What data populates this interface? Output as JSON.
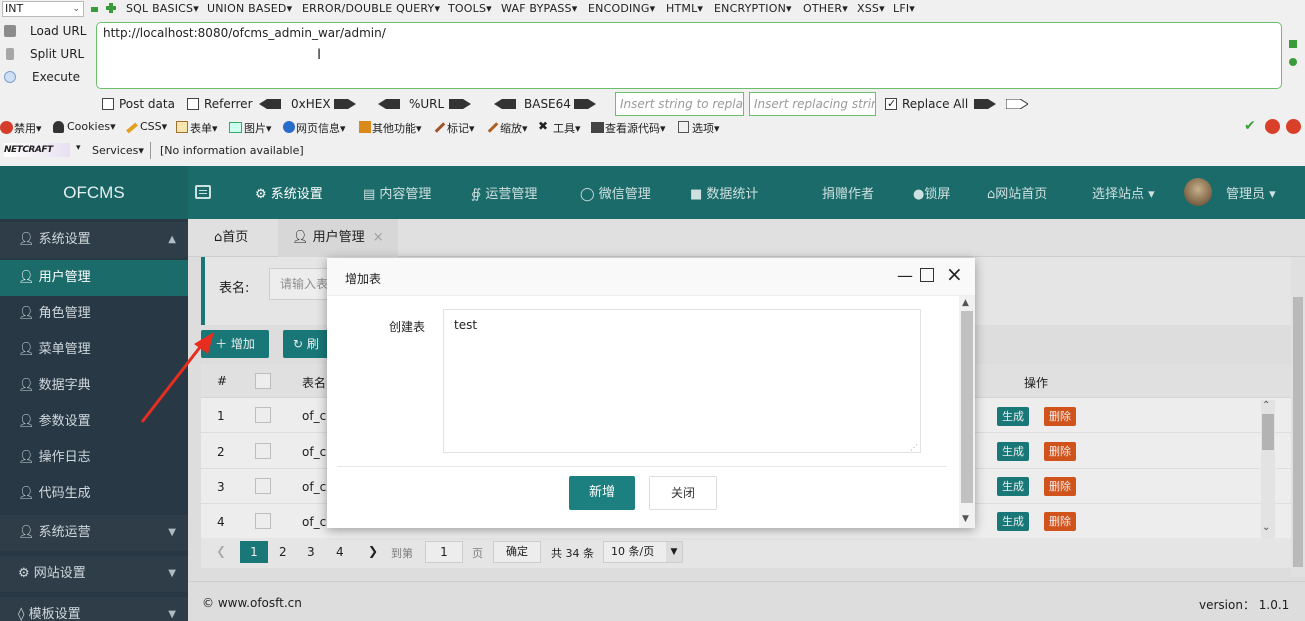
{
  "hackbar": {
    "type_select": "INT",
    "menus": [
      "SQL BASICS▾",
      "UNION BASED▾",
      "ERROR/DOUBLE QUERY▾",
      "TOOLS▾",
      "WAF BYPASS▾",
      "ENCODING▾",
      "HTML▾",
      "ENCRYPTION▾",
      "OTHER▾",
      "XSS▾",
      "LFI▾"
    ],
    "load_url": "Load URL",
    "split_url": "Split URL",
    "execute": "Execute",
    "url_value": "http://localhost:8080/ofcms_admin_war/admin/",
    "post_data": "Post data",
    "referrer": "Referrer",
    "hex": "0xHEX",
    "url_enc": "%URL",
    "base64": "BASE64",
    "insert_placeholder": "Insert string to replace",
    "replacing_placeholder": "Insert replacing string",
    "replace_all": "Replace All"
  },
  "webdev": {
    "items": [
      "禁用▾",
      "Cookies▾",
      "CSS▾",
      "表单▾",
      "图片▾",
      "网页信息▾",
      "其他功能▾",
      "标记▾",
      "缩放▾",
      "工具▾",
      "查看源代码▾",
      "选项▾"
    ]
  },
  "netcraft": {
    "logo": "NETCRAFT",
    "services": "Services▾",
    "info": "[No information available]"
  },
  "app": {
    "logo": "OFCMS",
    "nav": [
      "系统设置",
      "内容管理",
      "运营管理",
      "微信管理",
      "数据统计",
      "捐赠作者",
      "锁屏",
      "网站首页",
      "选择站点"
    ],
    "admin": "管理员"
  },
  "sidebar": {
    "items": [
      "系统设置",
      "用户管理",
      "角色管理",
      "菜单管理",
      "数据字典",
      "参数设置",
      "操作日志",
      "代码生成",
      "系统运营",
      "网站设置",
      "模板设置"
    ]
  },
  "tabs": [
    "首页",
    "用户管理"
  ],
  "filter": {
    "label": "表名:",
    "placeholder": "请输入表"
  },
  "toolbar": {
    "add": "增加",
    "refresh": "刷"
  },
  "table": {
    "headers": [
      "#",
      "表名",
      "操作"
    ],
    "rows": [
      {
        "num": "1",
        "name": "of_c"
      },
      {
        "num": "2",
        "name": "of_c"
      },
      {
        "num": "3",
        "name": "of_c"
      },
      {
        "num": "4",
        "name": "of_c"
      }
    ],
    "gen": "生成",
    "del": "删除"
  },
  "pager": {
    "pages": [
      "1",
      "2",
      "3",
      "4"
    ],
    "goto": "到第",
    "goto_value": "1",
    "page_unit": "页",
    "confirm": "确定",
    "total": "共 34 条",
    "per_page": "10 条/页"
  },
  "footer": {
    "copyright": "© www.ofosft.cn",
    "version": "version： 1.0.1"
  },
  "dialog": {
    "title": "增加表",
    "field_label": "创建表",
    "field_value": "test",
    "submit": "新增",
    "close": "关闭"
  },
  "colors": {
    "primary": "#1c8080",
    "sidebar": "#283845",
    "danger": "#e05a1e",
    "active_menu": "#1c6b6b"
  }
}
